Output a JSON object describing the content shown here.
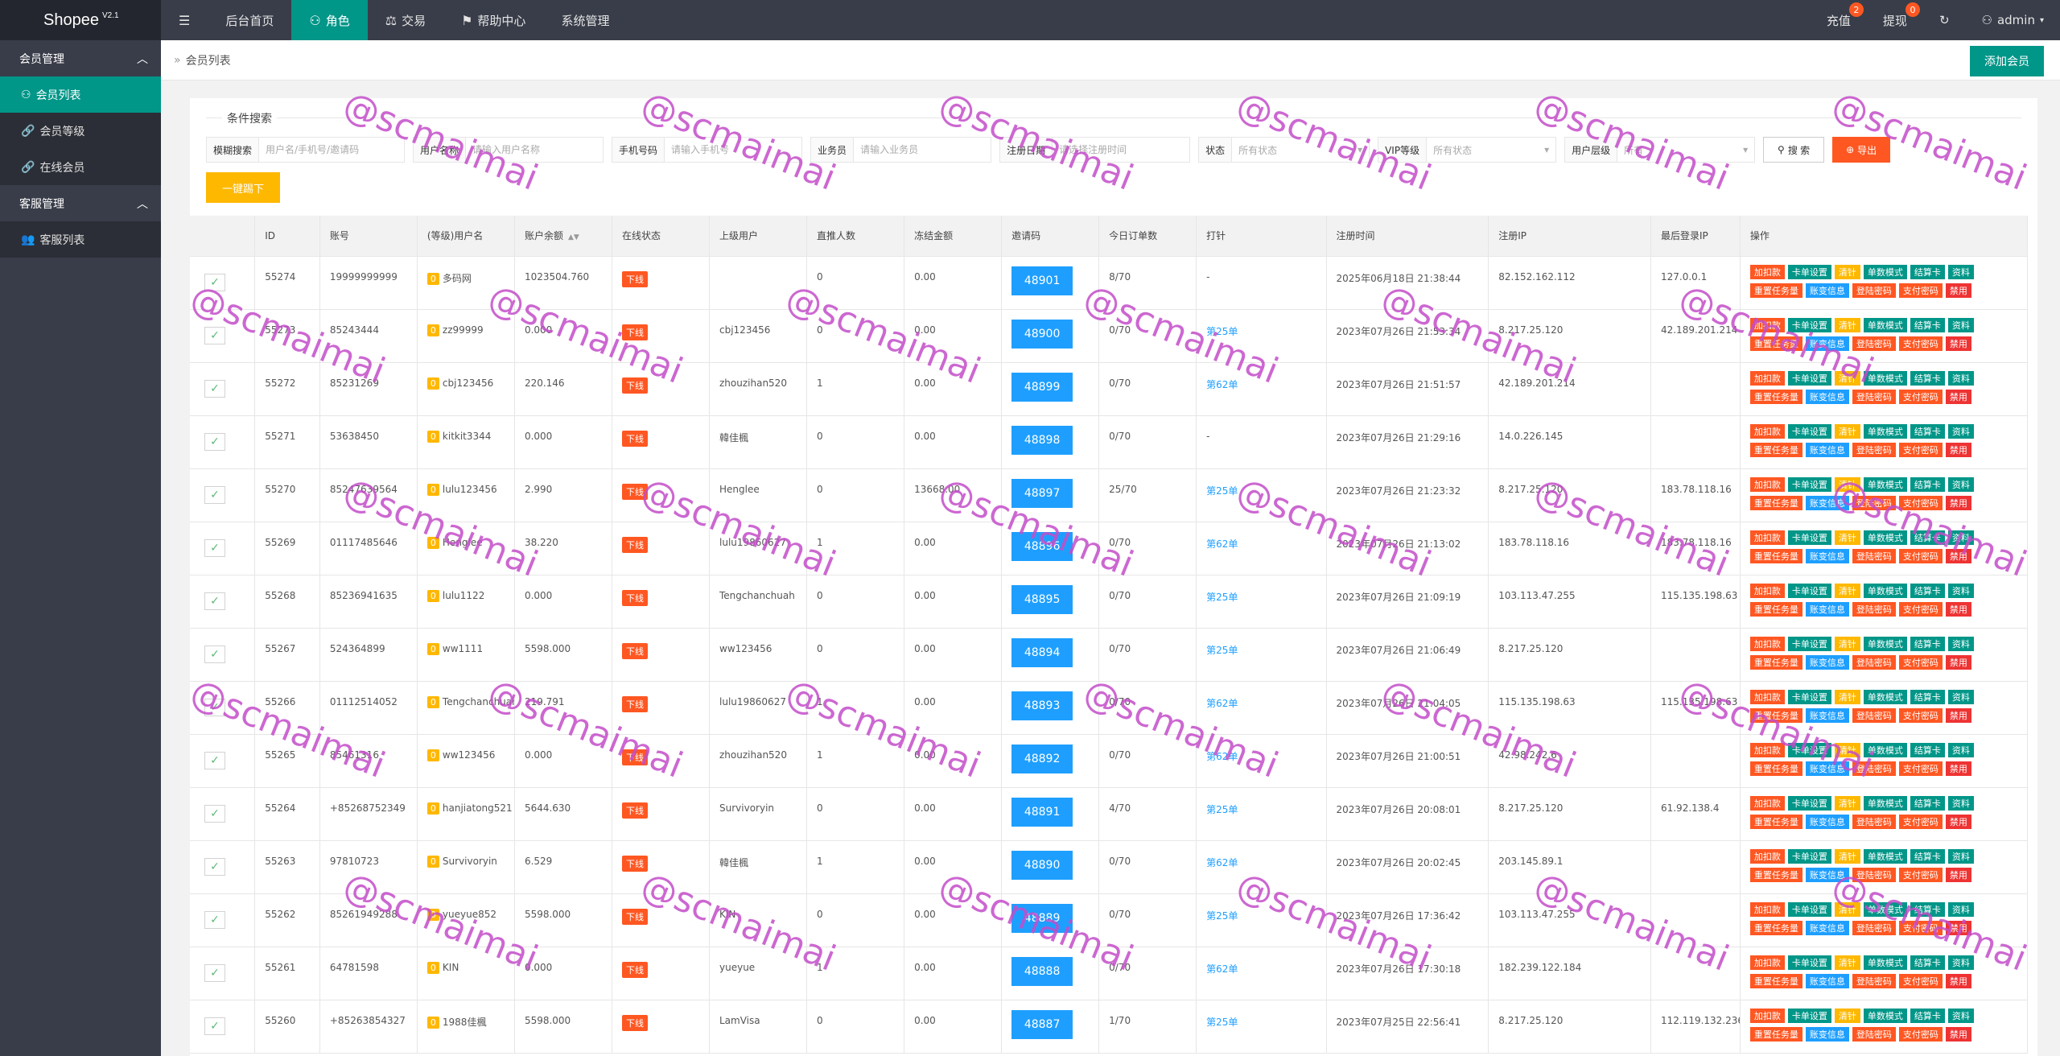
{
  "app": {
    "brand": "Shopee",
    "version": "V2.1"
  },
  "topnav": {
    "menu_icon": "menu-icon",
    "items": [
      {
        "label": "后台首页",
        "icon": ""
      },
      {
        "label": "角色",
        "icon": "user-icon",
        "active": true
      },
      {
        "label": "交易",
        "icon": "scale-icon"
      },
      {
        "label": "帮助中心",
        "icon": "flag-icon"
      },
      {
        "label": "系统管理",
        "icon": ""
      }
    ],
    "right": {
      "recharge": {
        "label": "充值",
        "badge": "2"
      },
      "withdraw": {
        "label": "提现",
        "badge": "0"
      },
      "refresh_icon": "refresh-icon",
      "user": "admin"
    }
  },
  "sidebar": {
    "groups": [
      {
        "label": "会员管理",
        "items": [
          {
            "label": "会员列表",
            "icon": "user-icon",
            "active": true
          },
          {
            "label": "会员等级",
            "icon": "link-icon"
          },
          {
            "label": "在线会员",
            "icon": "link-icon"
          }
        ]
      },
      {
        "label": "客服管理",
        "items": [
          {
            "label": "客服列表",
            "icon": "users-icon"
          }
        ]
      }
    ]
  },
  "breadcrumb": {
    "text": "会员列表"
  },
  "add_button": "添加会员",
  "search": {
    "legend": "条件搜索",
    "fuzzy": {
      "label": "模糊搜索",
      "placeholder": "用户名/手机号/邀请码"
    },
    "username": {
      "label": "用户名称",
      "placeholder": "请输入用户名称"
    },
    "phone": {
      "label": "手机号码",
      "placeholder": "请输入手机号"
    },
    "salesman": {
      "label": "业务员",
      "placeholder": "请输入业务员"
    },
    "regtime": {
      "label": "注册日期",
      "placeholder": "请选择注册时间"
    },
    "status": {
      "label": "状态",
      "value": "所有状态"
    },
    "vip": {
      "label": "VIP等级",
      "value": "所有状态"
    },
    "usertype": {
      "label": "用户层级",
      "value": "所有"
    },
    "search_btn": "搜 索",
    "export_btn": "导出",
    "kick_btn": "一键踢下"
  },
  "table": {
    "headers": [
      "",
      "ID",
      "账号",
      "(等级)用户名",
      "账户余额",
      "在线状态",
      "上级用户",
      "直推人数",
      "冻结金额",
      "邀请码",
      "今日订单数",
      "打针",
      "注册时间",
      "注册IP",
      "最后登录IP",
      "操作"
    ],
    "ops_row1": [
      {
        "label": "加扣款",
        "color": "red"
      },
      {
        "label": "卡单设置",
        "color": "green"
      },
      {
        "label": "清针",
        "color": "yellow"
      },
      {
        "label": "单数模式",
        "color": "green"
      },
      {
        "label": "结算卡",
        "color": "green"
      },
      {
        "label": "资料",
        "color": "green"
      }
    ],
    "ops_row2": [
      {
        "label": "重置任务量",
        "color": "red"
      },
      {
        "label": "账变信息",
        "color": "blue"
      },
      {
        "label": "登陆密码",
        "color": "red"
      },
      {
        "label": "支付密码",
        "color": "red"
      },
      {
        "label": "禁用",
        "color": "dark"
      }
    ],
    "rows": [
      {
        "id": "55274",
        "account": "19999999999",
        "level": "0",
        "username": "多码网",
        "balance": "1023504.760",
        "online": "下线",
        "parent": "",
        "direct": "0",
        "frozen": "0.00",
        "code": "48901",
        "orders": "8/70",
        "inject": "-",
        "regtime": "2025年06月18日 21:38:44",
        "regip": "82.152.162.112",
        "lastip": "127.0.0.1"
      },
      {
        "id": "55273",
        "account": "85243444",
        "level": "0",
        "username": "zz99999",
        "balance": "0.000",
        "online": "下线",
        "parent": "cbj123456",
        "direct": "0",
        "frozen": "0.00",
        "code": "48900",
        "orders": "0/70",
        "inject": "第25单",
        "regtime": "2023年07月26日 21:53:34",
        "regip": "8.217.25.120",
        "lastip": "42.189.201.214"
      },
      {
        "id": "55272",
        "account": "85231269",
        "level": "0",
        "username": "cbj123456",
        "balance": "220.146",
        "online": "下线",
        "parent": "zhouzihan520",
        "direct": "1",
        "frozen": "0.00",
        "code": "48899",
        "orders": "0/70",
        "inject": "第62单",
        "regtime": "2023年07月26日 21:51:57",
        "regip": "42.189.201.214",
        "lastip": ""
      },
      {
        "id": "55271",
        "account": "53638450",
        "level": "0",
        "username": "kitkit3344",
        "balance": "0.000",
        "online": "下线",
        "parent": "韓佳楓",
        "direct": "0",
        "frozen": "0.00",
        "code": "48898",
        "orders": "0/70",
        "inject": "-",
        "regtime": "2023年07月26日 21:29:16",
        "regip": "14.0.226.145",
        "lastip": ""
      },
      {
        "id": "55270",
        "account": "85247639564",
        "level": "0",
        "username": "lulu123456",
        "balance": "2.990",
        "online": "下线",
        "parent": "Henglee",
        "direct": "0",
        "frozen": "13668.00",
        "code": "48897",
        "orders": "25/70",
        "inject": "第25单",
        "regtime": "2023年07月26日 21:23:32",
        "regip": "8.217.25.120",
        "lastip": "183.78.118.16"
      },
      {
        "id": "55269",
        "account": "01117485646",
        "level": "0",
        "username": "Henglee",
        "balance": "38.220",
        "online": "下线",
        "parent": "lulu19860627",
        "direct": "1",
        "frozen": "0.00",
        "code": "48896",
        "orders": "0/70",
        "inject": "第62单",
        "regtime": "2023年07月26日 21:13:02",
        "regip": "183.78.118.16",
        "lastip": "183.78.118.16"
      },
      {
        "id": "55268",
        "account": "85236941635",
        "level": "0",
        "username": "lulu1122",
        "balance": "0.000",
        "online": "下线",
        "parent": "Tengchanchuah",
        "direct": "0",
        "frozen": "0.00",
        "code": "48895",
        "orders": "0/70",
        "inject": "第25单",
        "regtime": "2023年07月26日 21:09:19",
        "regip": "103.113.47.255",
        "lastip": "115.135.198.63"
      },
      {
        "id": "55267",
        "account": "524364899",
        "level": "0",
        "username": "ww1111",
        "balance": "5598.000",
        "online": "下线",
        "parent": "ww123456",
        "direct": "0",
        "frozen": "0.00",
        "code": "48894",
        "orders": "0/70",
        "inject": "第25单",
        "regtime": "2023年07月26日 21:06:49",
        "regip": "8.217.25.120",
        "lastip": ""
      },
      {
        "id": "55266",
        "account": "01112514052",
        "level": "0",
        "username": "Tengchanchuah",
        "balance": "219.791",
        "online": "下线",
        "parent": "lulu19860627",
        "direct": "1",
        "frozen": "0.00",
        "code": "48893",
        "orders": "0/70",
        "inject": "第62单",
        "regtime": "2023年07月26日 21:04:05",
        "regip": "115.135.198.63",
        "lastip": "115.135.198.63"
      },
      {
        "id": "55265",
        "account": "85461316",
        "level": "0",
        "username": "ww123456",
        "balance": "0.000",
        "online": "下线",
        "parent": "zhouzihan520",
        "direct": "1",
        "frozen": "0.00",
        "code": "48892",
        "orders": "0/70",
        "inject": "第62单",
        "regtime": "2023年07月26日 21:00:51",
        "regip": "42.98.242.6",
        "lastip": ""
      },
      {
        "id": "55264",
        "account": "+85268752349",
        "level": "0",
        "username": "hanjiatong521",
        "balance": "5644.630",
        "online": "下线",
        "parent": "Survivoryin",
        "direct": "0",
        "frozen": "0.00",
        "code": "48891",
        "orders": "4/70",
        "inject": "第25单",
        "regtime": "2023年07月26日 20:08:01",
        "regip": "8.217.25.120",
        "lastip": "61.92.138.4"
      },
      {
        "id": "55263",
        "account": "97810723",
        "level": "0",
        "username": "Survivoryin",
        "balance": "6.529",
        "online": "下线",
        "parent": "韓佳楓",
        "direct": "1",
        "frozen": "0.00",
        "code": "48890",
        "orders": "0/70",
        "inject": "第62单",
        "regtime": "2023年07月26日 20:02:45",
        "regip": "203.145.89.1",
        "lastip": ""
      },
      {
        "id": "55262",
        "account": "85261949288",
        "level": "0",
        "username": "yueyue852",
        "balance": "5598.000",
        "online": "下线",
        "parent": "KIN",
        "direct": "0",
        "frozen": "0.00",
        "code": "48889",
        "orders": "0/70",
        "inject": "第25单",
        "regtime": "2023年07月26日 17:36:42",
        "regip": "103.113.47.255",
        "lastip": ""
      },
      {
        "id": "55261",
        "account": "64781598",
        "level": "0",
        "username": "KIN",
        "balance": "0.000",
        "online": "下线",
        "parent": "yueyue",
        "direct": "1",
        "frozen": "0.00",
        "code": "48888",
        "orders": "0/70",
        "inject": "第62单",
        "regtime": "2023年07月26日 17:30:18",
        "regip": "182.239.122.184",
        "lastip": ""
      },
      {
        "id": "55260",
        "account": "+85263854327",
        "level": "0",
        "username": "1988佳楓",
        "balance": "5598.000",
        "online": "下线",
        "parent": "LamVisa",
        "direct": "0",
        "frozen": "0.00",
        "code": "48887",
        "orders": "1/70",
        "inject": "第25单",
        "regtime": "2023年07月25日 22:56:41",
        "regip": "8.217.25.120",
        "lastip": "112.119.132.236"
      }
    ]
  },
  "watermark": {
    "text": "@scmaimai",
    "color": "#c44dc9"
  }
}
